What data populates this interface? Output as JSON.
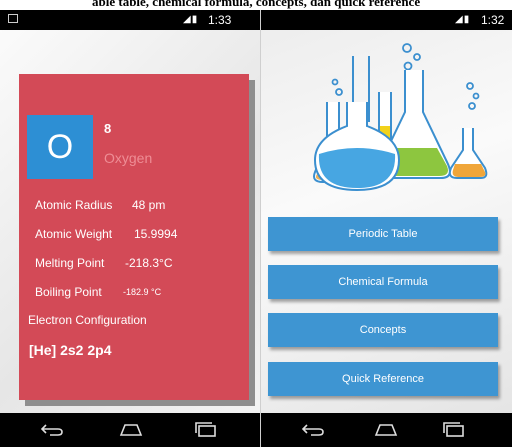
{
  "caption": "able table, chemical formula, concepts, dan quick reference",
  "left_screen": {
    "status_time": "1:33",
    "element": {
      "symbol": "O",
      "atomic_number": "8",
      "name": "Oxygen",
      "atomic_radius_label": "Atomic Radius",
      "atomic_radius_value": "48 pm",
      "atomic_weight_label": "Atomic Weight",
      "atomic_weight_value": "15.9994",
      "melting_point_label": "Melting Point",
      "melting_point_value": "-218.3°C",
      "boiling_point_label": "Boiling Point",
      "boiling_point_value": "-182.9 °C",
      "electron_config_label": "Electron Configuration",
      "electron_config_value": "[He] 2s2 2p4"
    },
    "colors": {
      "card": "#d34a57",
      "tile": "#2d8fd4"
    }
  },
  "right_screen": {
    "status_time": "1:32",
    "menu": [
      {
        "label": "Periodic Table"
      },
      {
        "label": "Chemical Formula"
      },
      {
        "label": "Concepts"
      },
      {
        "label": "Quick Reference"
      }
    ],
    "colors": {
      "button": "#3e95d2"
    }
  },
  "icons": [
    "back-icon",
    "home-icon",
    "recent-apps-icon",
    "signal-icon",
    "battery-icon",
    "picture-notification-icon"
  ]
}
